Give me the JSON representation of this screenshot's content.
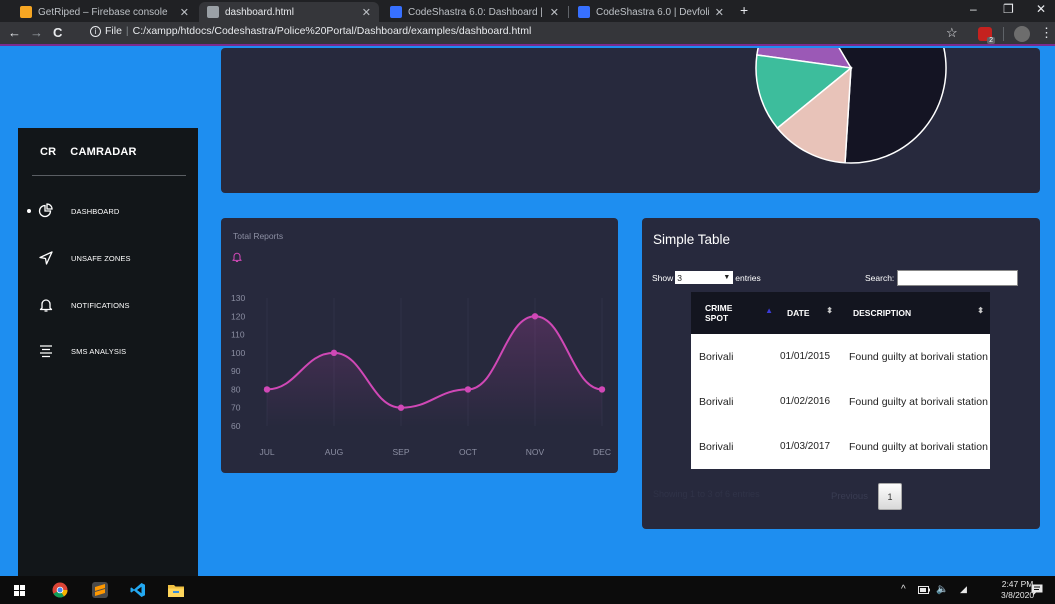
{
  "browser": {
    "tabs": [
      {
        "title": "GetRiped – Firebase console",
        "favicon_color": "#f6a623",
        "active": false
      },
      {
        "title": "dashboard.html",
        "favicon_color": "#9aa0a6",
        "active": true
      },
      {
        "title": "CodeShastra 6.0: Dashboard | De",
        "favicon_color": "#3770ff",
        "active": false
      },
      {
        "title": "CodeShastra 6.0 | Devfolio",
        "favicon_color": "#3770ff",
        "active": false
      }
    ],
    "url_scheme": "File",
    "url": "C:/xampp/htdocs/Codeshastra/Police%20Portal/Dashboard/examples/dashboard.html",
    "extension_badge": "2"
  },
  "sidebar": {
    "brand_mini": "CR",
    "brand_name": "CAMRADAR",
    "items": [
      {
        "label": "DASHBOARD",
        "icon": "pie-chart-icon",
        "active": true
      },
      {
        "label": "UNSAFE ZONES",
        "icon": "location-arrow-icon",
        "active": false
      },
      {
        "label": "NOTIFICATIONS",
        "icon": "bell-icon",
        "active": false
      },
      {
        "label": "SMS ANALYSIS",
        "icon": "align-lines-icon",
        "active": false
      }
    ]
  },
  "line_chart": {
    "category": "Total Reports",
    "icon": "bell-icon"
  },
  "chart_data": [
    {
      "type": "pie",
      "title": "",
      "slices": [
        {
          "value": 50,
          "color": "#141423"
        },
        {
          "value": 12,
          "color": "#9b59b6"
        },
        {
          "value": 11,
          "color": "#3dbd9c"
        },
        {
          "value": 11,
          "color": "#e8c3b9"
        }
      ]
    },
    {
      "type": "line",
      "title": "",
      "categories": [
        "JUL",
        "AUG",
        "SEP",
        "OCT",
        "NOV",
        "DEC"
      ],
      "series": [
        {
          "values": [
            80,
            100,
            70,
            80,
            120,
            80
          ]
        }
      ],
      "ylim": [
        60,
        130
      ],
      "yticks": [
        60,
        70,
        80,
        90,
        100,
        110,
        120,
        130
      ],
      "line_color": "#d048b6",
      "grid": true
    }
  ],
  "table": {
    "title": "Simple Table",
    "show_label": "Show",
    "entries_value": "3",
    "entries_label": "entries",
    "search_label": "Search:",
    "columns": [
      "CRIME SPOT",
      "DATE",
      "DESCRIPTION"
    ],
    "rows": [
      [
        "Borivali",
        "01/01/2015",
        "Found guilty at borivali station"
      ],
      [
        "Borivali",
        "01/02/2016",
        "Found guilty at borivali station"
      ],
      [
        "Borivali",
        "01/03/2017",
        "Found guilty at borivali station"
      ]
    ],
    "info": "Showing 1 to 3 of 6 entries",
    "previous_label": "Previous",
    "current_page": "1"
  },
  "taskbar": {
    "time": "2:47 PM",
    "date": "3/8/2020"
  }
}
